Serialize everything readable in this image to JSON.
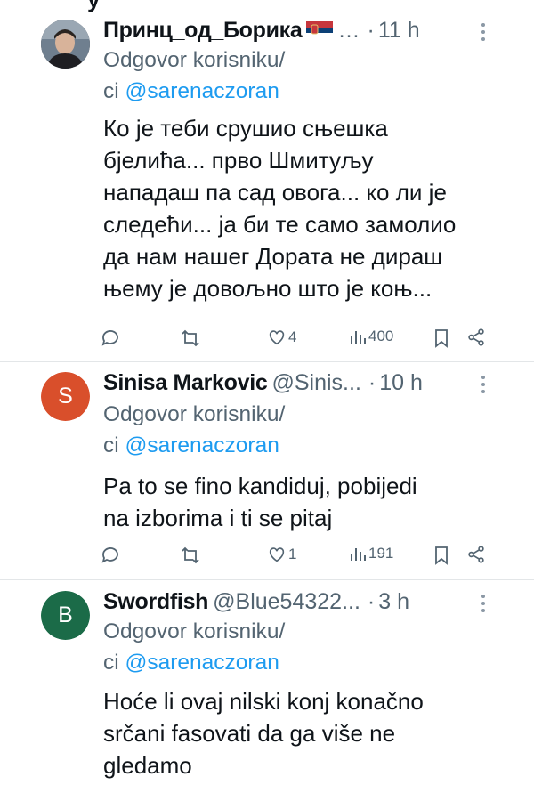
{
  "accent_color": "#1d9bf0",
  "muted_color": "#536471",
  "top_cut_text": "y",
  "tweets": [
    {
      "name": "Принц_од_Борика",
      "handle": "…",
      "time": "11 h",
      "avatar": {
        "type": "photo",
        "icon": "user-photo-avatar"
      },
      "reply_prefix": "Odgovor korisniku/",
      "reply_prefix2": "ci",
      "reply_mention": "@sarenaczoran",
      "lines": [
        "Ко је теби срушио сњешка",
        "бјелића... прво Шмитуљу",
        "нападаш па сад овога... ко ли је",
        "следећи... ја би те само замолио",
        "да нам нашег Дората не дираш",
        "њему је довољно што је коњ..."
      ],
      "likes": "4",
      "views": "400"
    },
    {
      "name": "Sinisa Markovic",
      "handle": "@Sinis...",
      "time": "10 h",
      "avatar": {
        "type": "letter",
        "letter": "S",
        "color": "#d94f2b"
      },
      "reply_prefix": "Odgovor korisniku/",
      "reply_prefix2": "ci",
      "reply_mention": "@sarenaczoran",
      "lines": [
        "Pa to se fino kandiduj, pobijedi",
        "na izborima i ti se pitaj"
      ],
      "likes": "1",
      "views": "191"
    },
    {
      "name": "Swordfish",
      "handle": "@Blue54322...",
      "time": "3 h",
      "avatar": {
        "type": "letter",
        "letter": "B",
        "color": "#1b6b48"
      },
      "reply_prefix": "Odgovor korisniku/",
      "reply_prefix2": "ci",
      "reply_mention": "@sarenaczoran",
      "lines": [
        "Hoće li ovaj nilski konj konačno",
        "srčani fasovati da ga više ne",
        "gledamo"
      ]
    }
  ]
}
